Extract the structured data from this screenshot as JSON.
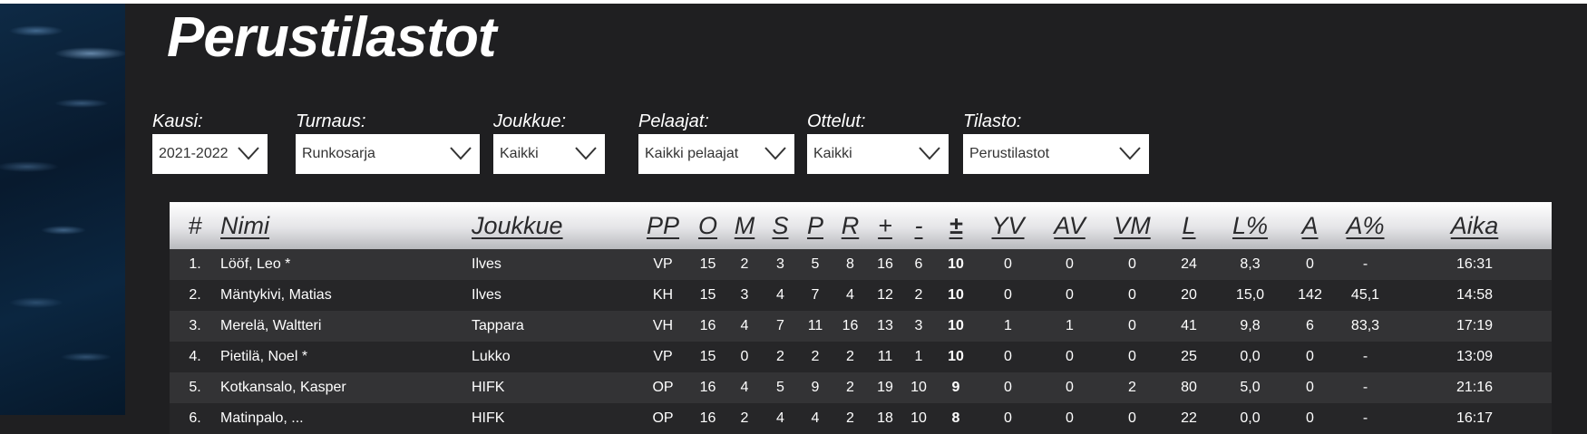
{
  "page": {
    "title": "Perustilastot"
  },
  "filters": [
    {
      "label": "Kausi:",
      "value": "2021-2022"
    },
    {
      "label": "Turnaus:",
      "value": "Runkosarja"
    },
    {
      "label": "Joukkue:",
      "value": "Kaikki"
    },
    {
      "label": "Pelaajat:",
      "value": "Kaikki pelaajat"
    },
    {
      "label": "Ottelut:",
      "value": "Kaikki"
    },
    {
      "label": "Tilasto:",
      "value": "Perustilastot"
    }
  ],
  "table": {
    "headers": [
      "#",
      "Nimi",
      "Joukkue",
      "PP",
      "O",
      "M",
      "S",
      "P",
      "R",
      "+",
      "-",
      "±",
      "YV",
      "AV",
      "VM",
      "L",
      "L%",
      "A",
      "A%",
      "Aika"
    ],
    "rows": [
      [
        "1.",
        "Lööf, Leo *",
        "Ilves",
        "VP",
        "15",
        "2",
        "3",
        "5",
        "8",
        "16",
        "6",
        "10",
        "0",
        "0",
        "0",
        "24",
        "8,3",
        "0",
        "-",
        "16:31"
      ],
      [
        "2.",
        "Mäntykivi, Matias",
        "Ilves",
        "KH",
        "15",
        "3",
        "4",
        "7",
        "4",
        "12",
        "2",
        "10",
        "0",
        "0",
        "0",
        "20",
        "15,0",
        "142",
        "45,1",
        "14:58"
      ],
      [
        "3.",
        "Merelä, Waltteri",
        "Tappara",
        "VH",
        "16",
        "4",
        "7",
        "11",
        "16",
        "13",
        "3",
        "10",
        "1",
        "1",
        "0",
        "41",
        "9,8",
        "6",
        "83,3",
        "17:19"
      ],
      [
        "4.",
        "Pietilä, Noel *",
        "Lukko",
        "VP",
        "15",
        "0",
        "2",
        "2",
        "2",
        "11",
        "1",
        "10",
        "0",
        "0",
        "0",
        "25",
        "0,0",
        "0",
        "-",
        "13:09"
      ],
      [
        "5.",
        "Kotkansalo, Kasper",
        "HIFK",
        "OP",
        "16",
        "4",
        "5",
        "9",
        "2",
        "19",
        "10",
        "9",
        "0",
        "0",
        "2",
        "80",
        "5,0",
        "0",
        "-",
        "21:16"
      ],
      [
        "6.",
        "Matinpalo, ...",
        "HIFK",
        "OP",
        "16",
        "2",
        "4",
        "4",
        "2",
        "18",
        "10",
        "8",
        "0",
        "0",
        "0",
        "22",
        "0,0",
        "0",
        "-",
        "16:17"
      ]
    ]
  },
  "colors": {
    "background": "#1f1f21",
    "row_odd": "#333335",
    "row_even": "#262628",
    "header_gradient_top": "#ffffff",
    "header_gradient_bottom": "#b8b9bd"
  },
  "icons": {
    "select_arrow": "chevron-down-icon"
  }
}
